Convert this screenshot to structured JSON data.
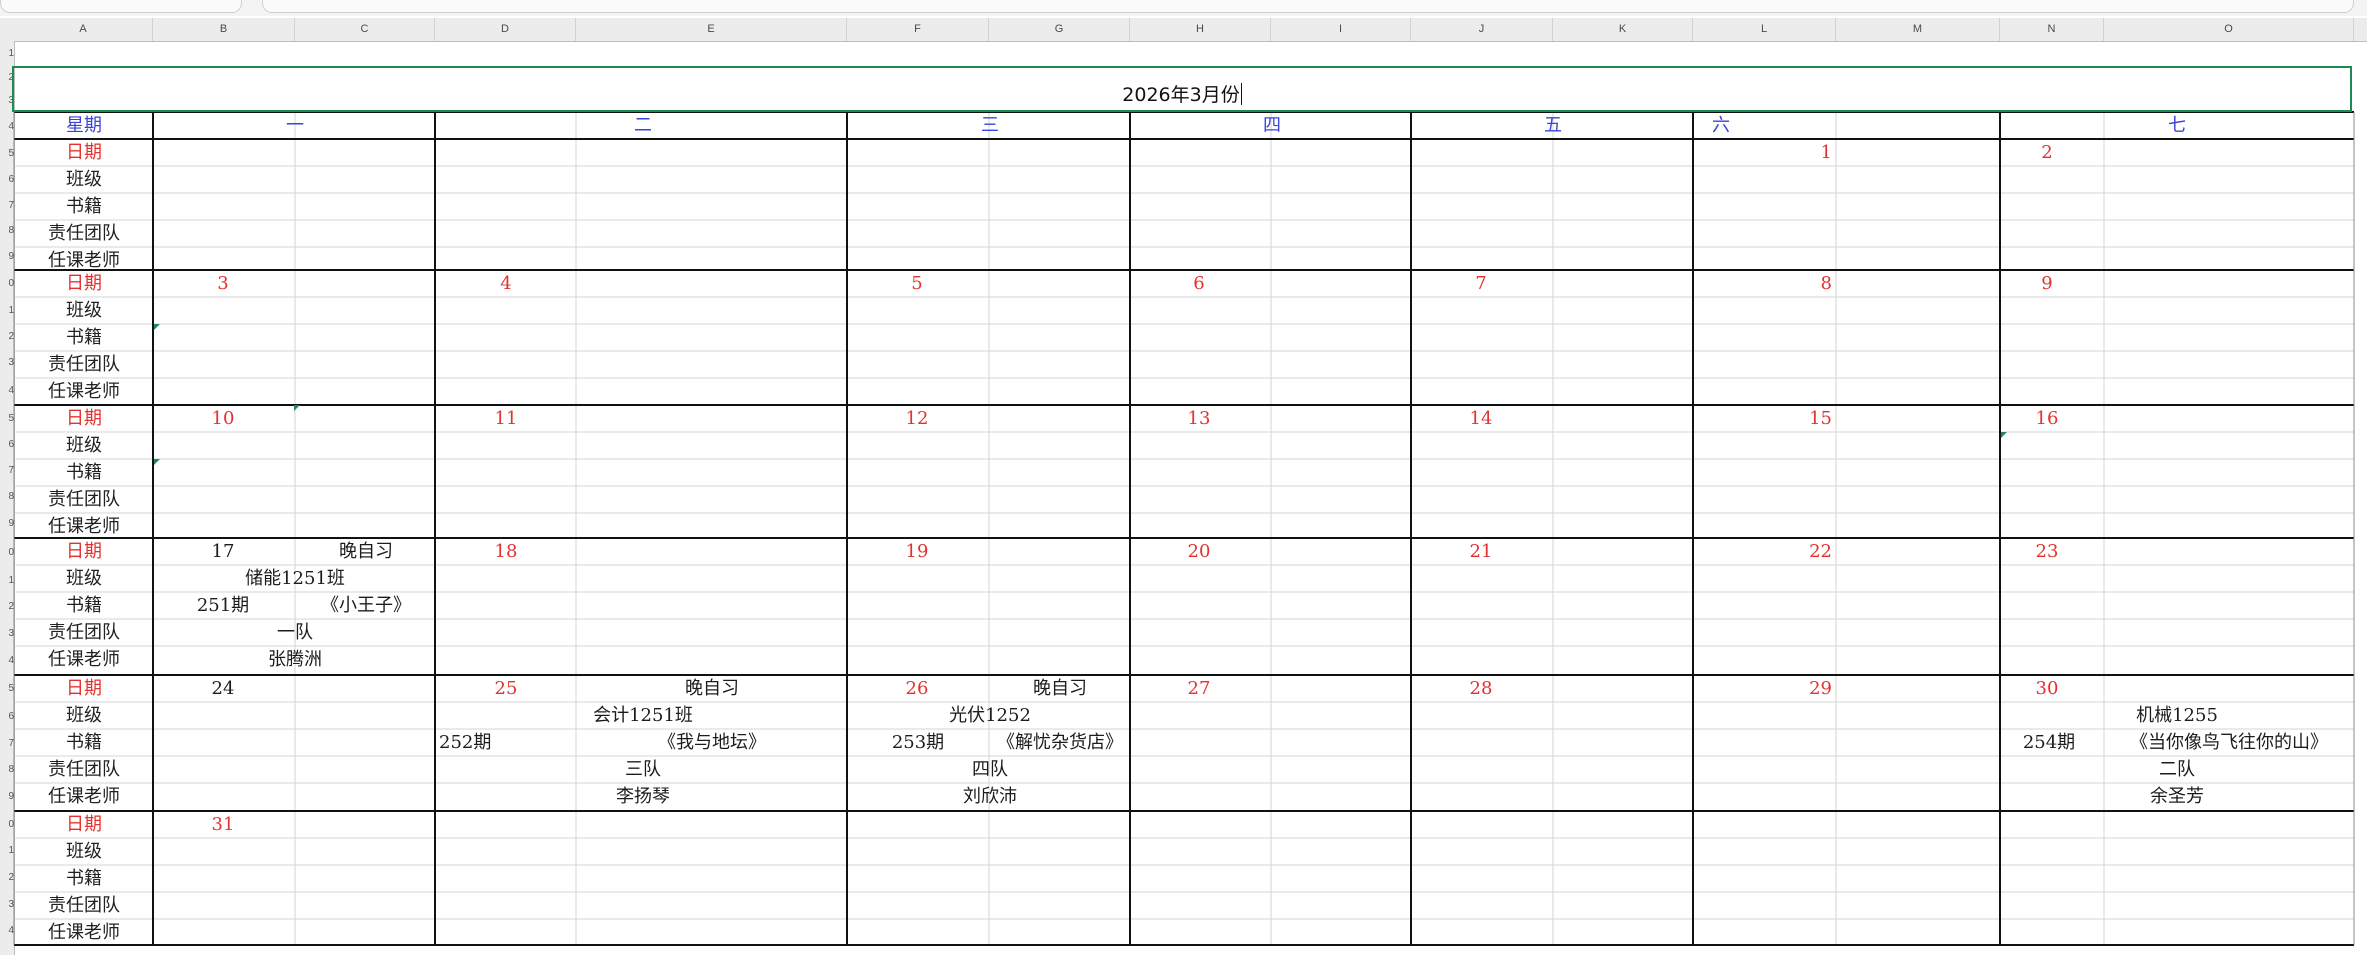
{
  "columns": [
    "A",
    "B",
    "C",
    "D",
    "E",
    "F",
    "G",
    "H",
    "I",
    "J",
    "K",
    "L",
    "M",
    "N",
    "O"
  ],
  "sheet_title": "2026年3月份",
  "weekday_header": {
    "label": "星期",
    "days": [
      "一",
      "二",
      "三",
      "四",
      "五",
      "六",
      "七"
    ]
  },
  "row_labels": [
    "日期",
    "班级",
    "书籍",
    "责任团队",
    "任课老师"
  ],
  "weeks": [
    {
      "dates": [
        "",
        "",
        "",
        "",
        "",
        "1",
        "2"
      ]
    },
    {
      "dates": [
        "3",
        "4",
        "5",
        "6",
        "7",
        "8",
        "9"
      ]
    },
    {
      "dates": [
        "10",
        "11",
        "12",
        "13",
        "14",
        "15",
        "16"
      ]
    },
    {
      "dates": [
        "17",
        "18",
        "19",
        "20",
        "21",
        "22",
        "23"
      ]
    },
    {
      "dates": [
        "24",
        "25",
        "26",
        "27",
        "28",
        "29",
        "30"
      ]
    },
    {
      "dates": [
        "31",
        "",
        "",
        "",
        "",
        "",
        ""
      ]
    }
  ],
  "events": [
    {
      "tag": "晚自习",
      "class": "储能1251班",
      "period": "251期",
      "book": "《小王子》",
      "team": "一队",
      "teacher": "张腾洲"
    },
    {
      "tag": "晚自习",
      "class": "会计1251班",
      "period": "252期",
      "book": "《我与地坛》",
      "team": "三队",
      "teacher": "李扬琴"
    },
    {
      "tag": "晚自习",
      "class": "光伏1252",
      "period": "253期",
      "book": "《解忧杂货店》",
      "team": "四队",
      "teacher": "刘欣沛"
    },
    {
      "tag": "",
      "class": "机械1255",
      "period": "254期",
      "book": "《当你像鸟飞往你的山》",
      "team": "二队",
      "teacher": "余圣芳"
    }
  ],
  "colors": {
    "accent_green": "#1e8a57",
    "date_red": "#e4312f",
    "header_blue": "#3a44d8"
  }
}
